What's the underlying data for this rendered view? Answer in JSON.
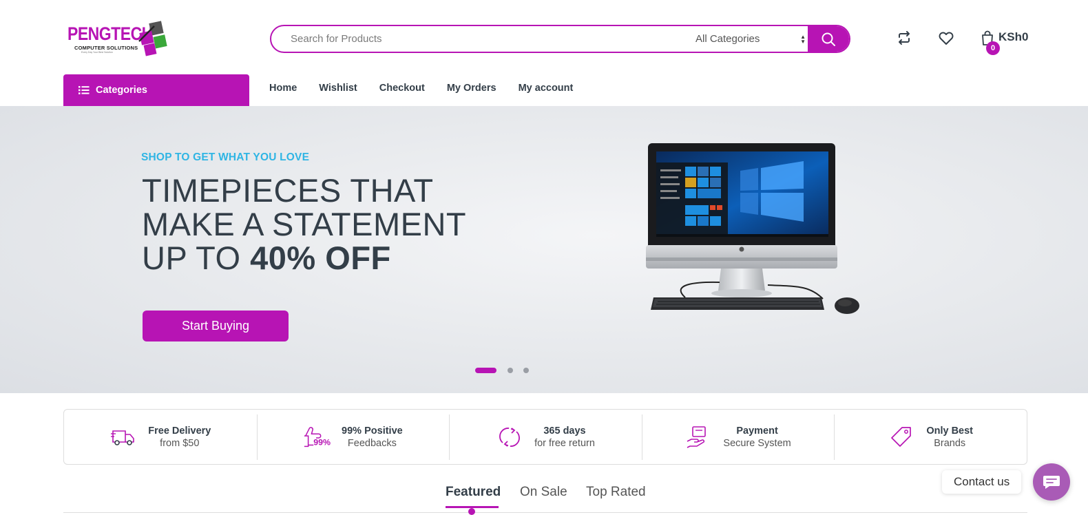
{
  "brand": {
    "name": "PENGTECH",
    "subtitle": "COMPUTER SOLUTIONS",
    "tagline": "Every Day Your Best Solution"
  },
  "colors": {
    "accent": "#b714b4",
    "eyebrow": "#2fb5e4",
    "text": "#333e48"
  },
  "search": {
    "placeholder": "Search for Products",
    "category_selected": "All Categories",
    "button_icon": "search-icon"
  },
  "header_icons": [
    "compare-icon",
    "wishlist-heart-icon",
    "cart-bag-icon"
  ],
  "cart": {
    "count": "0",
    "total": "KSh0"
  },
  "categories_button": {
    "label": "Categories",
    "icon": "list-icon"
  },
  "nav": {
    "items": [
      "Home",
      "Wishlist",
      "Checkout",
      "My Orders",
      "My account"
    ]
  },
  "hero": {
    "eyebrow": "SHOP TO GET WHAT YOU LOVE",
    "line1": "TIMEPIECES THAT",
    "line2": "MAKE A STATEMENT",
    "line3_prefix": "UP TO ",
    "line3_bold": "40% OFF",
    "cta": "Start Buying",
    "image": "all-in-one-desktop-computer",
    "slides": 3,
    "active_slide": 1
  },
  "features": [
    {
      "icon": "delivery-truck-icon",
      "title": "Free Delivery",
      "sub": "from $50"
    },
    {
      "icon": "thumbs-up-99-icon",
      "title": "99% Positive",
      "sub": "Feedbacks"
    },
    {
      "icon": "return-arrows-icon",
      "title": "365 days",
      "sub": "for free return"
    },
    {
      "icon": "payment-hand-icon",
      "title": "Payment",
      "sub": "Secure System"
    },
    {
      "icon": "price-tag-icon",
      "title": "Only Best",
      "sub": "Brands"
    }
  ],
  "tabs": {
    "items": [
      "Featured",
      "On Sale",
      "Top Rated"
    ],
    "active": "Featured"
  },
  "contact": {
    "label": "Contact us",
    "icon": "chat-icon"
  }
}
